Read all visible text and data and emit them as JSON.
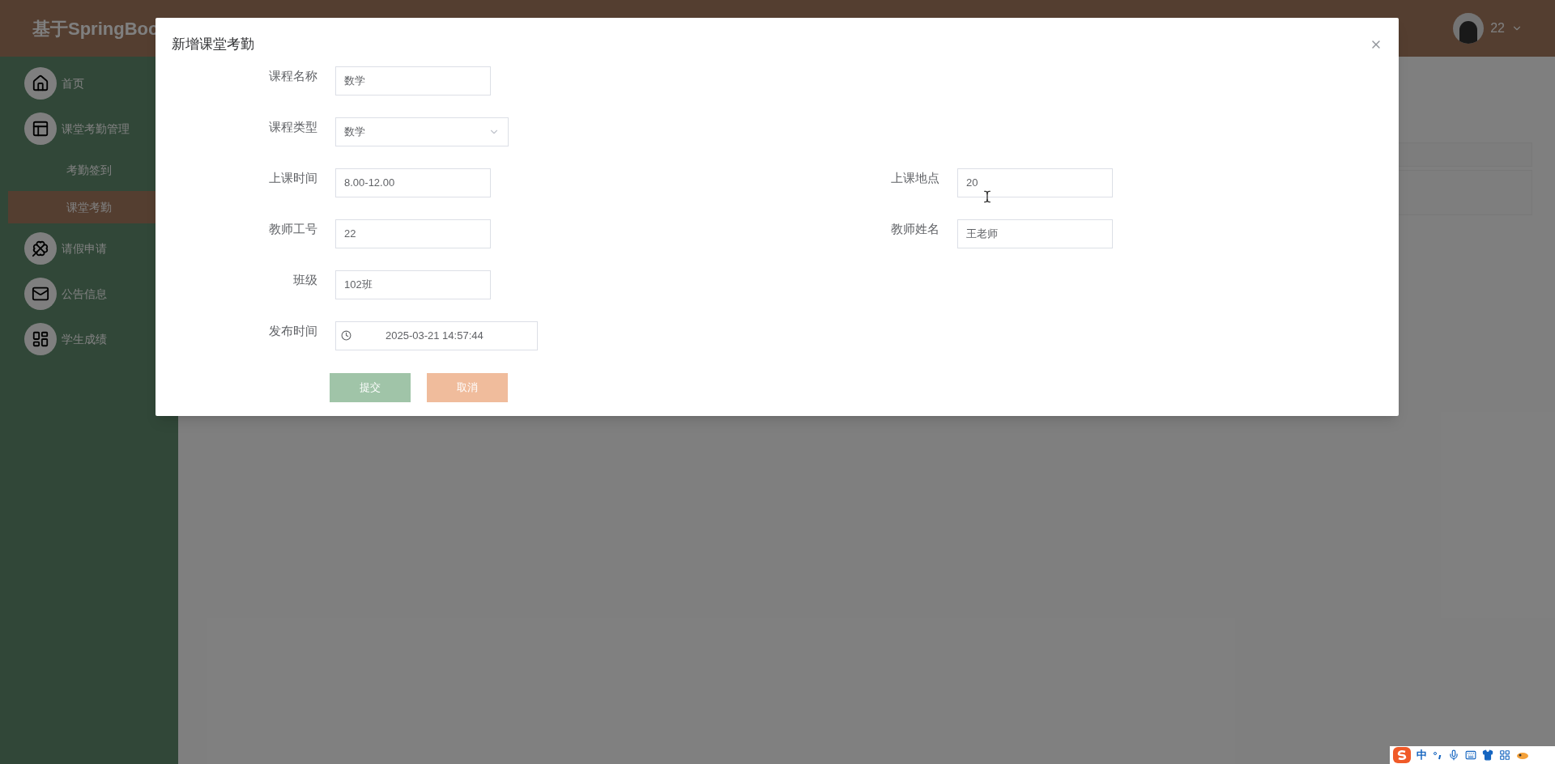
{
  "app": {
    "title": "基于SpringBoo"
  },
  "user": {
    "name": "22"
  },
  "sidebar": {
    "items": [
      {
        "label": "首页",
        "selected": false
      },
      {
        "label": "课堂考勤管理",
        "selected": false,
        "children": [
          {
            "label": "考勤签到",
            "selected": false
          },
          {
            "label": "课堂考勤",
            "selected": true
          }
        ]
      },
      {
        "label": "请假申请",
        "selected": false
      },
      {
        "label": "公告信息",
        "selected": false
      },
      {
        "label": "学生成绩",
        "selected": false
      }
    ]
  },
  "dialog": {
    "title": "新增课堂考勤",
    "rows": [
      {
        "left": {
          "label": "课程名称",
          "value": "数学",
          "kind": "text"
        }
      },
      {
        "left": {
          "label": "课程类型",
          "value": "数学",
          "kind": "select"
        }
      },
      {
        "left": {
          "label": "上课时间",
          "value": "8.00-12.00",
          "kind": "text"
        },
        "right": {
          "label": "上课地点",
          "value": "20",
          "kind": "text"
        }
      },
      {
        "left": {
          "label": "教师工号",
          "value": "22",
          "kind": "text"
        },
        "right": {
          "label": "教师姓名",
          "value": "王老师",
          "kind": "text"
        }
      },
      {
        "left": {
          "label": "班级",
          "value": "102班",
          "kind": "text"
        }
      },
      {
        "left": {
          "label": "发布时间",
          "value": "2025-03-21 14:57:44",
          "kind": "datetime"
        }
      }
    ],
    "buttons": [
      {
        "label": "提交",
        "kind": "primary"
      },
      {
        "label": "取消",
        "kind": "cancel"
      }
    ]
  },
  "ime": {
    "mode": "中"
  }
}
